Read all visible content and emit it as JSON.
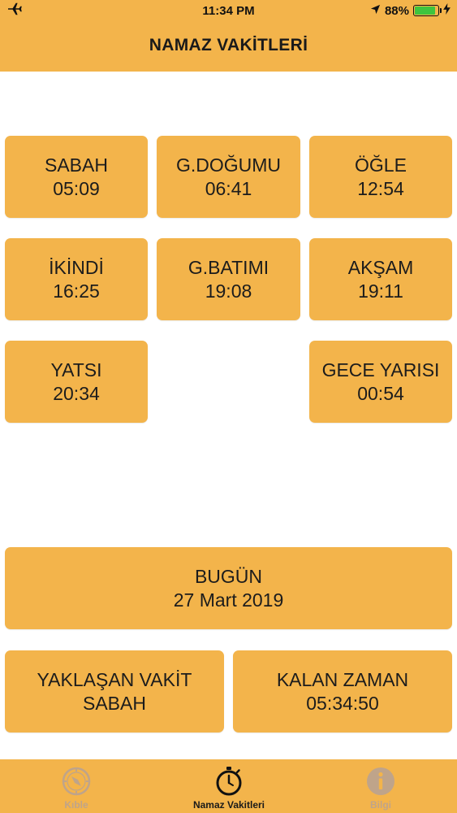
{
  "status_bar": {
    "time": "11:34 PM",
    "battery_percent": "88%",
    "battery_level": 0.88,
    "icons": [
      "airplane-icon",
      "location-arrow-icon",
      "battery-icon",
      "charging-bolt-icon"
    ]
  },
  "header": {
    "title": "NAMAZ VAKİTLERİ"
  },
  "times": [
    {
      "name": "SABAH",
      "time": "05:09"
    },
    {
      "name": "G.DOĞUMU",
      "time": "06:41"
    },
    {
      "name": "ÖĞLE",
      "time": "12:54"
    },
    {
      "name": "İKİNDİ",
      "time": "16:25"
    },
    {
      "name": "G.BATIMI",
      "time": "19:08"
    },
    {
      "name": "AKŞAM",
      "time": "19:11"
    },
    {
      "name": "YATSI",
      "time": "20:34"
    },
    {
      "name": "GECE YARISI",
      "time": "00:54"
    }
  ],
  "today": {
    "label": "BUGÜN",
    "date": "27 Mart 2019"
  },
  "upcoming": {
    "label": "YAKLAŞAN VAKİT",
    "value": "SABAH"
  },
  "remaining": {
    "label": "KALAN ZAMAN",
    "value": "05:34:50"
  },
  "tabs": [
    {
      "label": "Kıble",
      "icon": "compass-icon",
      "active": false
    },
    {
      "label": "Namaz Vakitleri",
      "icon": "stopwatch-icon",
      "active": true
    },
    {
      "label": "Bilgi",
      "icon": "info-icon",
      "active": false
    }
  ],
  "colors": {
    "accent": "#f3b44b",
    "background": "#ffffff",
    "battery": "#3ec43e",
    "inactive_tab": "#bfa48a"
  }
}
